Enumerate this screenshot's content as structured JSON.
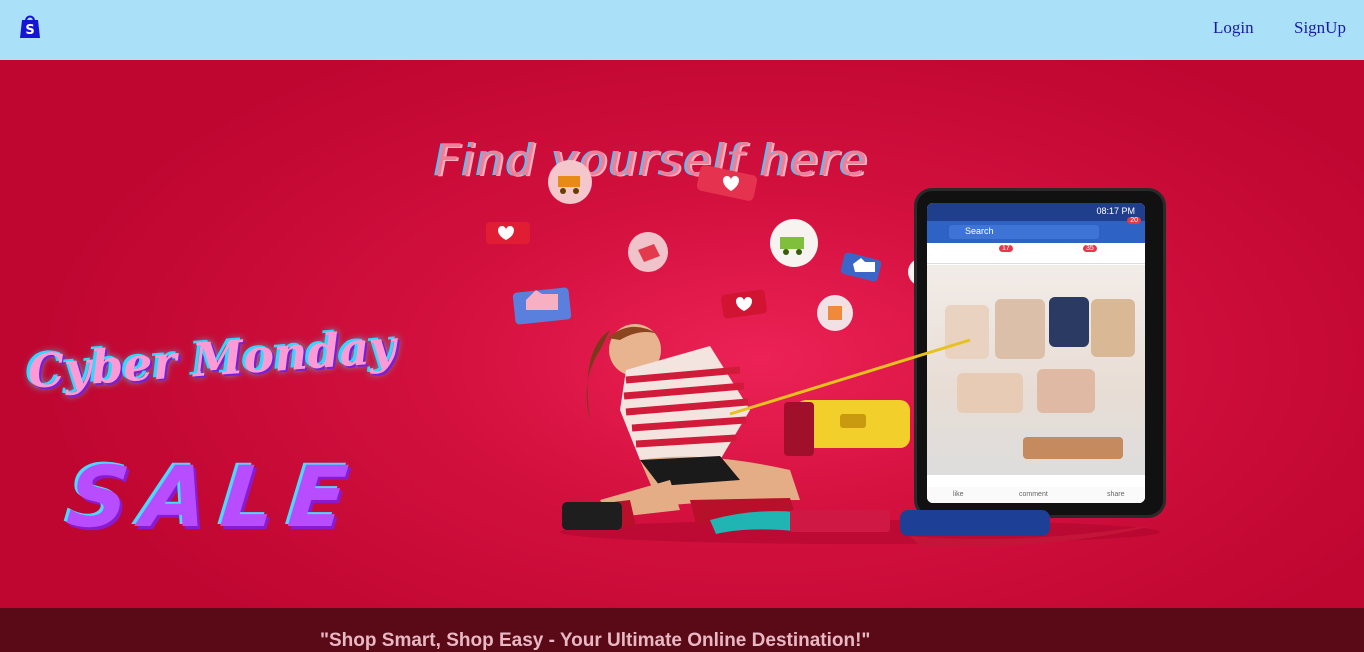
{
  "nav": {
    "logo_icon": "shopping-bag-icon",
    "login_label": "Login",
    "signup_label": "SignUp"
  },
  "hero": {
    "tagline": "Find yourself here",
    "promo_line1": "Cyber Monday",
    "promo_line2": "SALE",
    "phone": {
      "time": "08:17 PM",
      "search_placeholder": "Search",
      "notification_count": "20",
      "friend_requests": "17",
      "alerts": "35",
      "like_label": "like",
      "comment_label": "comment",
      "share_label": "share"
    }
  },
  "footer": {
    "slogan": "\"Shop Smart, Shop Easy - Your Ultimate Online Destination!\""
  },
  "colors": {
    "nav_bg": "#abe1f8",
    "link": "#1a1aa8",
    "hero_red": "#d3103e",
    "accent_cyan": "#2fd9ff",
    "accent_purple": "#b84cff"
  }
}
